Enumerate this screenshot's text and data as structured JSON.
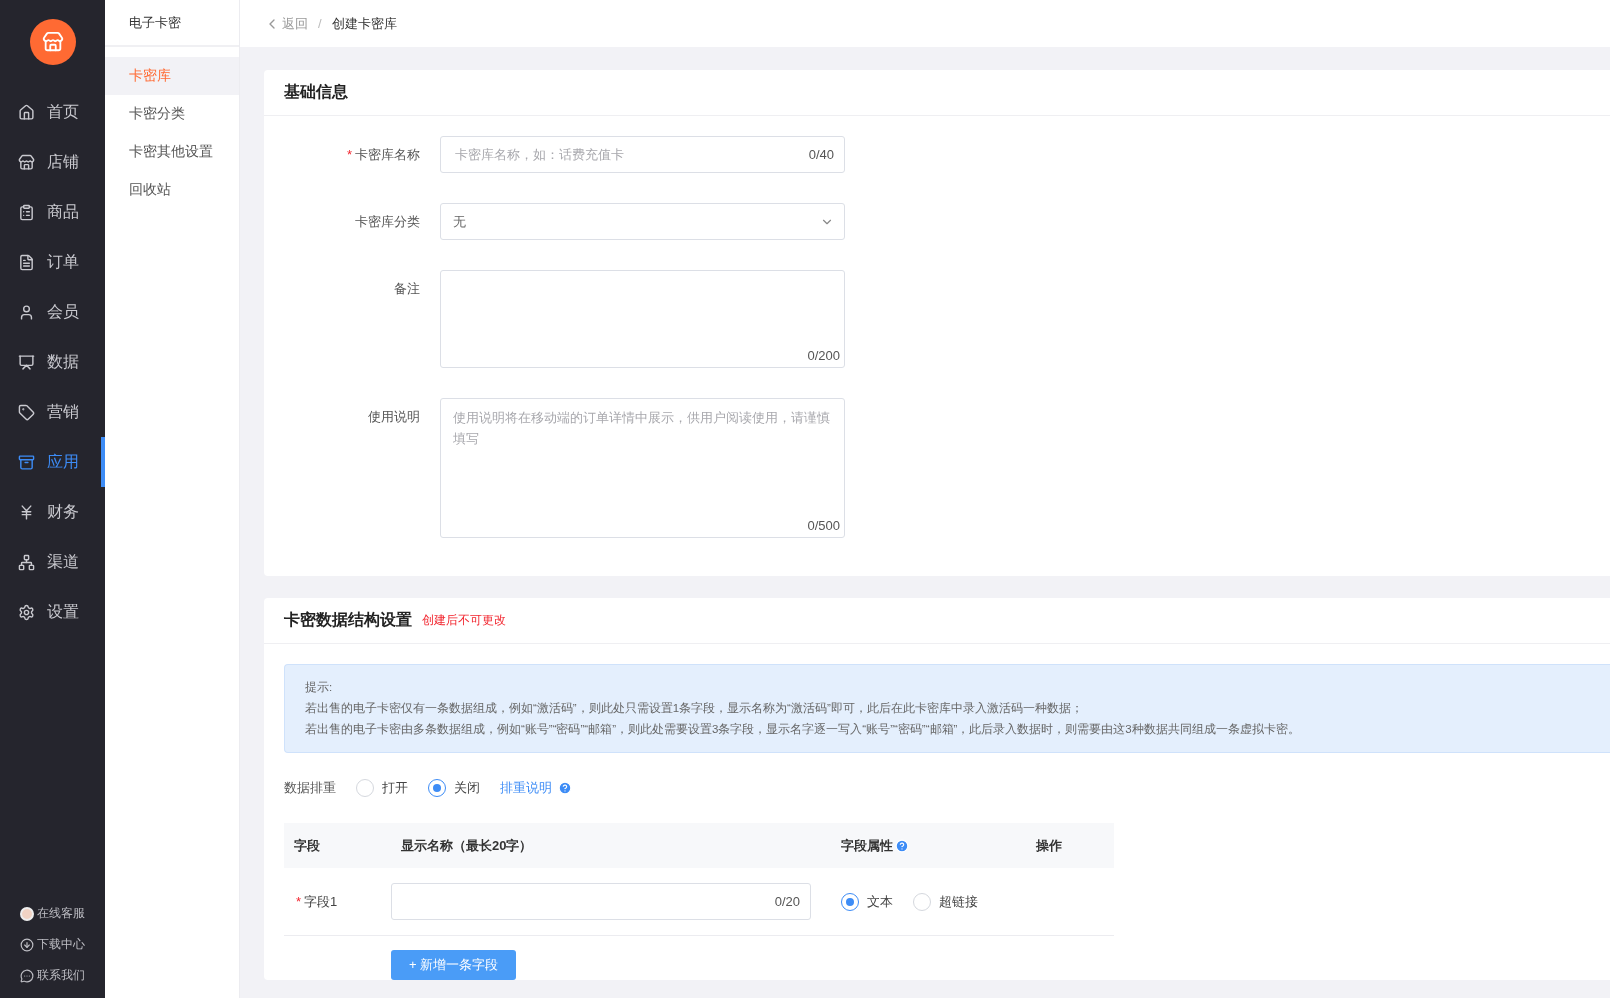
{
  "nav": {
    "items": [
      {
        "label": "首页",
        "selected": false
      },
      {
        "label": "店铺",
        "selected": false
      },
      {
        "label": "商品",
        "selected": false
      },
      {
        "label": "订单",
        "selected": false
      },
      {
        "label": "会员",
        "selected": false
      },
      {
        "label": "数据",
        "selected": false
      },
      {
        "label": "营销",
        "selected": false
      },
      {
        "label": "应用",
        "selected": true
      },
      {
        "label": "财务",
        "selected": false
      },
      {
        "label": "渠道",
        "selected": false
      },
      {
        "label": "设置",
        "selected": false
      }
    ],
    "footer": [
      {
        "label": "在线客服"
      },
      {
        "label": "下载中心"
      },
      {
        "label": "联系我们"
      }
    ]
  },
  "subnav": {
    "title": "电子卡密",
    "items": [
      {
        "label": "卡密库",
        "selected": true
      },
      {
        "label": "卡密分类",
        "selected": false
      },
      {
        "label": "卡密其他设置",
        "selected": false
      },
      {
        "label": "回收站",
        "selected": false
      }
    ]
  },
  "required_mark": "*",
  "breadcrumb": {
    "back": "返回",
    "separator": "/",
    "current": "创建卡密库"
  },
  "basic": {
    "title": "基础信息",
    "fields": [
      {
        "kind": "text",
        "label": "卡密库名称",
        "required": true,
        "placeholder": "卡密库名称，如：话费充值卡",
        "counter": "0/40"
      },
      {
        "kind": "select",
        "label": "卡密库分类",
        "required": false,
        "value": "无"
      },
      {
        "kind": "textarea",
        "label": "备注",
        "required": false,
        "counter": "0/200"
      },
      {
        "kind": "textarea",
        "label": "使用说明",
        "required": false,
        "placeholder": "使用说明将在移动端的订单详情中展示，供用户阅读使用，请谨慎填写",
        "counter": "0/500"
      }
    ]
  },
  "structure": {
    "title": "卡密数据结构设置",
    "warning": "创建后不可更改",
    "tip": {
      "title": "提示:",
      "lines": [
        "若出售的电子卡密仅有一条数据组成，例如“激活码”，则此处只需设置1条字段，显示名称为“激活码”即可，此后在此卡密库中录入激活码一种数据；",
        "若出售的电子卡密由多条数据组成，例如“账号”“密码”“邮箱”，则此处需要设置3条字段，显示名字逐一写入“账号”“密码”“邮箱”，此后录入数据时，则需要由这3种数据共同组成一条虚拟卡密。"
      ]
    },
    "dedupe": {
      "label": "数据排重",
      "options": [
        {
          "label": "打开",
          "selected": false
        },
        {
          "label": "关闭",
          "selected": true
        }
      ],
      "help_link": "排重说明"
    },
    "table": {
      "columns": [
        {
          "label": "字段",
          "help": false
        },
        {
          "label": "显示名称（最长20字）",
          "help": false
        },
        {
          "label": "字段属性",
          "help": true
        },
        {
          "label": "操作",
          "help": false
        }
      ],
      "rows": [
        {
          "field": "字段1",
          "required": true,
          "counter": "0/20",
          "types": [
            {
              "label": "文本",
              "selected": true
            },
            {
              "label": "超链接",
              "selected": false
            }
          ]
        }
      ]
    },
    "add_button": "+ 新增一条字段"
  }
}
